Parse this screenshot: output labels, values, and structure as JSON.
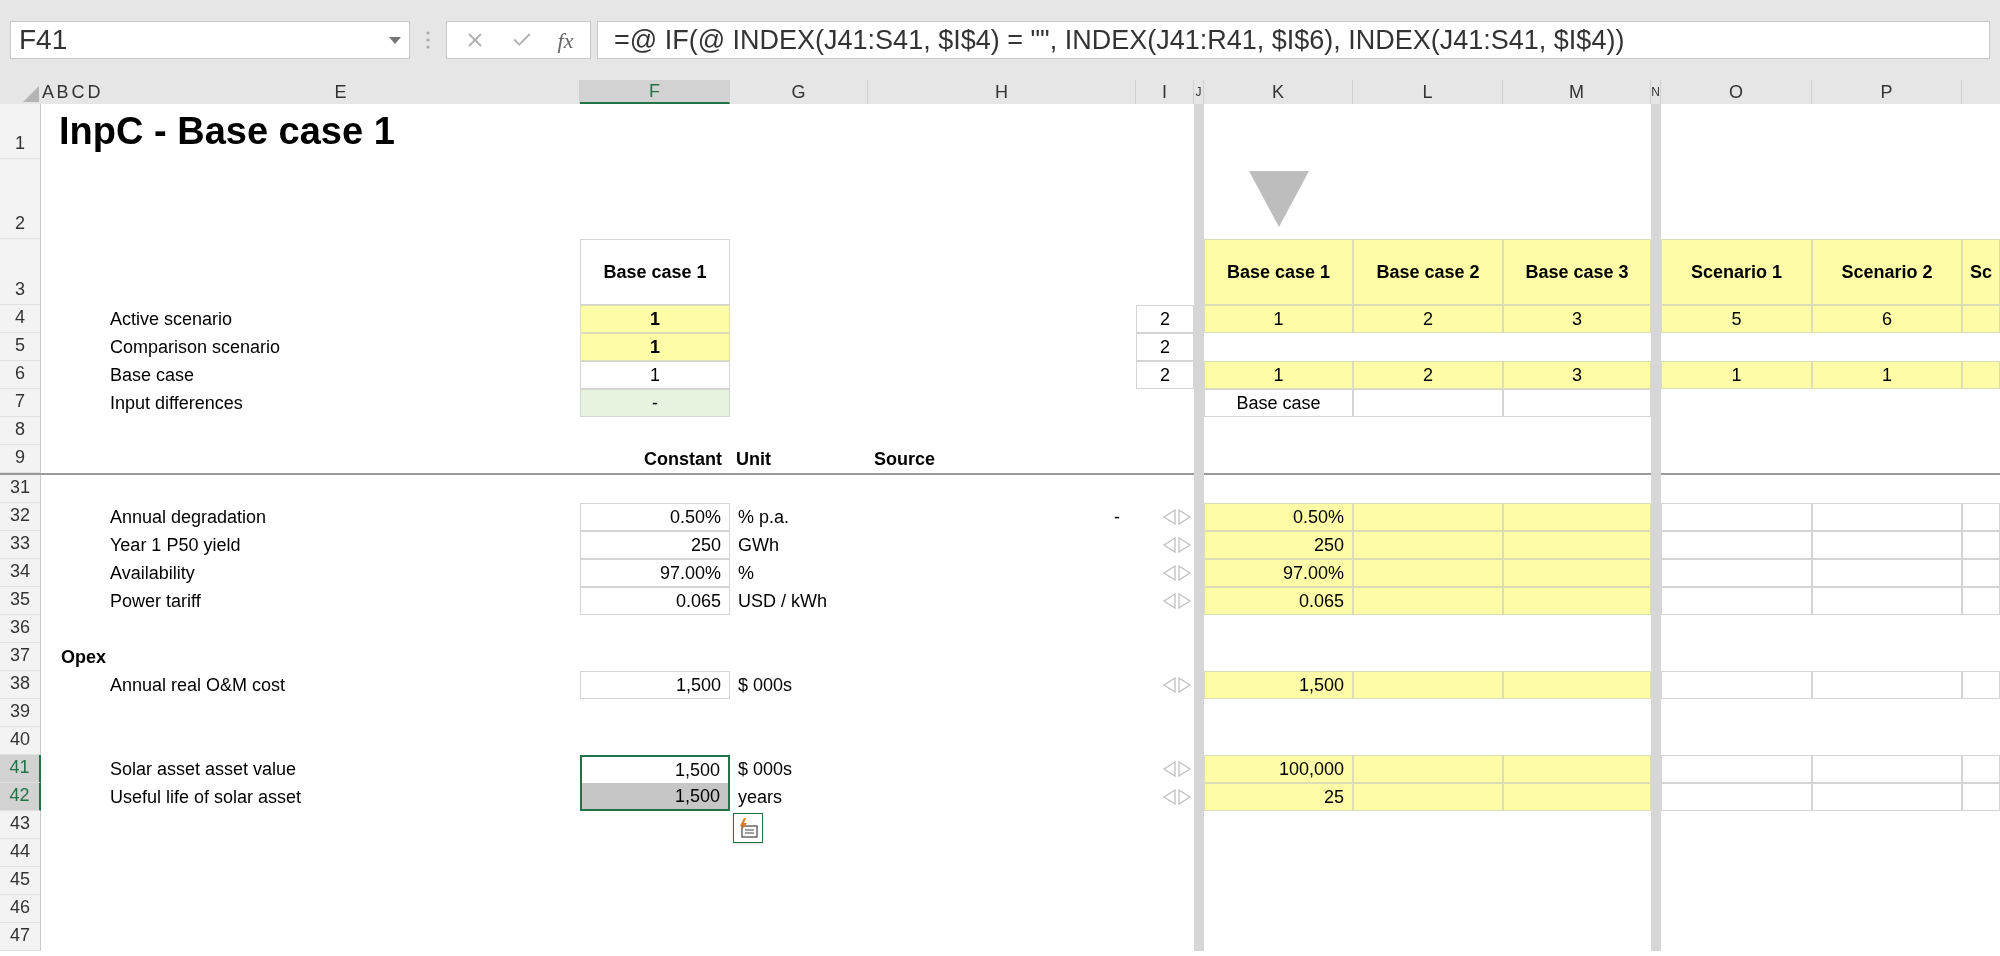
{
  "formula_bar": {
    "name_box": "F41",
    "function_button": "fx",
    "formula": "=@ IF(@ INDEX(J41:S41, $I$4) = \"\", INDEX(J41:R41, $I$6), INDEX(J41:S41, $I$4))"
  },
  "columns": [
    {
      "label": "A",
      "selected": false
    },
    {
      "label": "B",
      "selected": false
    },
    {
      "label": "C",
      "selected": false
    },
    {
      "label": "D",
      "selected": false
    },
    {
      "label": "E",
      "selected": false
    },
    {
      "label": "F",
      "selected": true
    },
    {
      "label": "G",
      "selected": false
    },
    {
      "label": "H",
      "selected": false
    },
    {
      "label": "I",
      "selected": false
    },
    {
      "label": "J",
      "selected": false
    },
    {
      "label": "K",
      "selected": false
    },
    {
      "label": "L",
      "selected": false
    },
    {
      "label": "M",
      "selected": false
    },
    {
      "label": "N",
      "selected": false
    },
    {
      "label": "O",
      "selected": false
    },
    {
      "label": "P",
      "selected": false
    }
  ],
  "frozen_rows": [
    {
      "header": "1",
      "selected": false,
      "cells": {
        "B": {
          "kind": "title",
          "text": "InpC - Base case 1",
          "selected": false
        }
      }
    },
    {
      "header": "2",
      "selected": false,
      "cells": {
        "K": {
          "kind": "marker",
          "selected": false
        }
      }
    },
    {
      "header": "3",
      "selected": false,
      "cells": {
        "F": {
          "kind": "col-title",
          "text": "Base case 1",
          "selected": false
        },
        "K": {
          "kind": "scenario-title",
          "text": "Base case 1",
          "selected": false
        },
        "L": {
          "kind": "scenario-title",
          "text": "Base case 2",
          "selected": false
        },
        "M": {
          "kind": "scenario-title",
          "text": "Base case 3",
          "selected": false
        },
        "O": {
          "kind": "scenario-title",
          "text": "Scenario 1",
          "selected": false
        },
        "P": {
          "kind": "scenario-title",
          "text": "Scenario 2",
          "selected": false
        },
        "Q": {
          "kind": "scenario-title",
          "text": "Sc",
          "selected": false
        }
      }
    },
    {
      "header": "4",
      "selected": false,
      "cells": {
        "E": {
          "kind": "label",
          "text": "Active scenario",
          "selected": false
        },
        "F": {
          "kind": "switch",
          "text": "1",
          "selected": false
        },
        "I": {
          "kind": "ghost",
          "text": "2",
          "selected": false
        },
        "K": {
          "kind": "index",
          "text": "1",
          "selected": false
        },
        "L": {
          "kind": "index",
          "text": "2",
          "selected": false
        },
        "M": {
          "kind": "index",
          "text": "3",
          "selected": false
        },
        "O": {
          "kind": "index",
          "text": "5",
          "selected": false
        },
        "P": {
          "kind": "index",
          "text": "6",
          "selected": false
        },
        "Q": {
          "kind": "index",
          "selected": false
        }
      }
    },
    {
      "header": "5",
      "selected": false,
      "cells": {
        "E": {
          "kind": "label",
          "text": "Comparison scenario",
          "selected": false
        },
        "F": {
          "kind": "switch",
          "text": "1",
          "selected": false
        },
        "I": {
          "kind": "ghost",
          "text": "2",
          "selected": false
        }
      }
    },
    {
      "header": "6",
      "selected": false,
      "cells": {
        "E": {
          "kind": "label",
          "text": "Base case",
          "selected": false
        },
        "F": {
          "kind": "index-plain",
          "text": "1",
          "selected": false
        },
        "I": {
          "kind": "ghost",
          "text": "2",
          "selected": false
        },
        "K": {
          "kind": "index",
          "text": "1",
          "selected": false
        },
        "L": {
          "kind": "index",
          "text": "2",
          "selected": false
        },
        "M": {
          "kind": "index",
          "text": "3",
          "selected": false
        },
        "O": {
          "kind": "index",
          "text": "1",
          "selected": false
        },
        "P": {
          "kind": "index",
          "text": "1",
          "selected": false
        },
        "Q": {
          "kind": "index",
          "selected": false
        }
      }
    },
    {
      "header": "7",
      "selected": false,
      "cells": {
        "E": {
          "kind": "label",
          "text": "Input differences",
          "selected": false
        },
        "F": {
          "kind": "check",
          "text": "-",
          "selected": false
        },
        "K": {
          "kind": "index-plain",
          "text": "Base case",
          "selected": false
        },
        "L": {
          "kind": "index-plain",
          "selected": false
        },
        "M": {
          "kind": "index-plain",
          "selected": false
        }
      }
    },
    {
      "header": "8",
      "selected": false,
      "cells": {}
    },
    {
      "header": "9",
      "selected": false,
      "cells": {
        "F": {
          "kind": "heading-end",
          "text": "Constant",
          "selected": false
        },
        "G": {
          "kind": "heading",
          "text": "Unit",
          "selected": false
        },
        "H": {
          "kind": "heading",
          "text": "Source",
          "selected": false
        }
      }
    }
  ],
  "rows": [
    {
      "header": "31",
      "selected": false,
      "cells": {}
    },
    {
      "header": "32",
      "selected": false,
      "cells": {
        "E": {
          "kind": "label",
          "text": "Annual degradation",
          "selected": false
        },
        "F": {
          "kind": "constant",
          "text": "0.50%",
          "selected": false
        },
        "G": {
          "kind": "label",
          "text": "% p.a.",
          "selected": false
        },
        "H": {
          "kind": "note",
          "text": "-",
          "selected": false
        },
        "I": {
          "kind": "arrows",
          "selected": false
        },
        "K": {
          "kind": "input",
          "text": "0.50%",
          "selected": false
        },
        "L": {
          "kind": "input",
          "selected": false
        },
        "M": {
          "kind": "input",
          "selected": false
        },
        "O": {
          "kind": "empty-box",
          "selected": false
        },
        "P": {
          "kind": "empty-box",
          "selected": false
        },
        "Q": {
          "kind": "empty-box",
          "selected": false
        }
      }
    },
    {
      "header": "33",
      "selected": false,
      "cells": {
        "E": {
          "kind": "label",
          "text": "Year 1 P50 yield",
          "selected": false
        },
        "F": {
          "kind": "constant",
          "text": "250",
          "selected": false
        },
        "G": {
          "kind": "label",
          "text": "GWh",
          "selected": false
        },
        "I": {
          "kind": "arrows",
          "selected": false
        },
        "K": {
          "kind": "input",
          "text": "250",
          "selected": false
        },
        "L": {
          "kind": "input",
          "selected": false
        },
        "M": {
          "kind": "input",
          "selected": false
        },
        "O": {
          "kind": "empty-box",
          "selected": false
        },
        "P": {
          "kind": "empty-box",
          "selected": false
        },
        "Q": {
          "kind": "empty-box",
          "selected": false
        }
      }
    },
    {
      "header": "34",
      "selected": false,
      "cells": {
        "E": {
          "kind": "label",
          "text": "Availability",
          "selected": false
        },
        "F": {
          "kind": "constant",
          "text": "97.00%",
          "selected": false
        },
        "G": {
          "kind": "label",
          "text": "%",
          "selected": false
        },
        "I": {
          "kind": "arrows",
          "selected": false
        },
        "K": {
          "kind": "input",
          "text": "97.00%",
          "selected": false
        },
        "L": {
          "kind": "input",
          "selected": false
        },
        "M": {
          "kind": "input",
          "selected": false
        },
        "O": {
          "kind": "empty-box",
          "selected": false
        },
        "P": {
          "kind": "empty-box",
          "selected": false
        },
        "Q": {
          "kind": "empty-box",
          "selected": false
        }
      }
    },
    {
      "header": "35",
      "selected": false,
      "cells": {
        "E": {
          "kind": "label",
          "text": "Power tariff",
          "selected": false
        },
        "F": {
          "kind": "constant",
          "text": "0.065",
          "selected": false
        },
        "G": {
          "kind": "label",
          "text": "USD / kWh",
          "selected": false
        },
        "I": {
          "kind": "arrows",
          "selected": false
        },
        "K": {
          "kind": "input",
          "text": "0.065",
          "selected": false
        },
        "L": {
          "kind": "input",
          "selected": false
        },
        "M": {
          "kind": "input",
          "selected": false
        },
        "O": {
          "kind": "empty-box",
          "selected": false
        },
        "P": {
          "kind": "empty-box",
          "selected": false
        },
        "Q": {
          "kind": "empty-box",
          "selected": false
        }
      }
    },
    {
      "header": "36",
      "selected": false,
      "cells": {}
    },
    {
      "header": "37",
      "selected": false,
      "cells": {
        "B": {
          "kind": "heading",
          "text": "Opex",
          "selected": false
        }
      }
    },
    {
      "header": "38",
      "selected": false,
      "cells": {
        "E": {
          "kind": "label",
          "text": "Annual real O&M cost",
          "selected": false
        },
        "F": {
          "kind": "constant",
          "text": "1,500",
          "selected": false
        },
        "G": {
          "kind": "label",
          "text": "$ 000s",
          "selected": false
        },
        "I": {
          "kind": "arrows",
          "selected": false
        },
        "K": {
          "kind": "input",
          "text": "1,500",
          "selected": false
        },
        "L": {
          "kind": "input",
          "selected": false
        },
        "M": {
          "kind": "input",
          "selected": false
        },
        "O": {
          "kind": "empty-box",
          "selected": false
        },
        "P": {
          "kind": "empty-box",
          "selected": false
        },
        "Q": {
          "kind": "empty-box",
          "selected": false
        }
      }
    },
    {
      "header": "39",
      "selected": false,
      "cells": {}
    },
    {
      "header": "40",
      "selected": false,
      "cells": {}
    },
    {
      "header": "41",
      "selected": true,
      "cells": {
        "E": {
          "kind": "label",
          "text": "Solar asset asset value",
          "selected": false
        },
        "F": {
          "kind": "constant",
          "text": "1,500",
          "selected": true
        },
        "G": {
          "kind": "label",
          "text": "$ 000s",
          "selected": false
        },
        "I": {
          "kind": "arrows",
          "selected": false
        },
        "K": {
          "kind": "input",
          "text": "100,000",
          "selected": false
        },
        "L": {
          "kind": "input",
          "selected": false
        },
        "M": {
          "kind": "input",
          "selected": false
        },
        "O": {
          "kind": "empty-box",
          "selected": false
        },
        "P": {
          "kind": "empty-box",
          "selected": false
        },
        "Q": {
          "kind": "empty-box",
          "selected": false
        }
      }
    },
    {
      "header": "42",
      "selected": true,
      "cells": {
        "E": {
          "kind": "label",
          "text": "Useful life of solar asset",
          "selected": false
        },
        "F": {
          "kind": "constant",
          "text": "1,500",
          "selected": true
        },
        "G": {
          "kind": "label",
          "text": "years",
          "selected": false
        },
        "I": {
          "kind": "arrows",
          "selected": false
        },
        "K": {
          "kind": "input",
          "text": "25",
          "selected": false
        },
        "L": {
          "kind": "input",
          "selected": false
        },
        "M": {
          "kind": "input",
          "selected": false
        },
        "O": {
          "kind": "empty-box",
          "selected": false
        },
        "P": {
          "kind": "empty-box",
          "selected": false
        },
        "Q": {
          "kind": "empty-box",
          "selected": false
        }
      }
    },
    {
      "header": "43",
      "selected": false,
      "cells": {
        "G": {
          "kind": "quick-analysis",
          "selected": false
        }
      }
    },
    {
      "header": "44",
      "selected": false,
      "cells": {}
    },
    {
      "header": "45",
      "selected": false,
      "cells": {}
    },
    {
      "header": "46",
      "selected": false,
      "cells": {}
    },
    {
      "header": "47",
      "selected": false,
      "cells": {}
    }
  ]
}
